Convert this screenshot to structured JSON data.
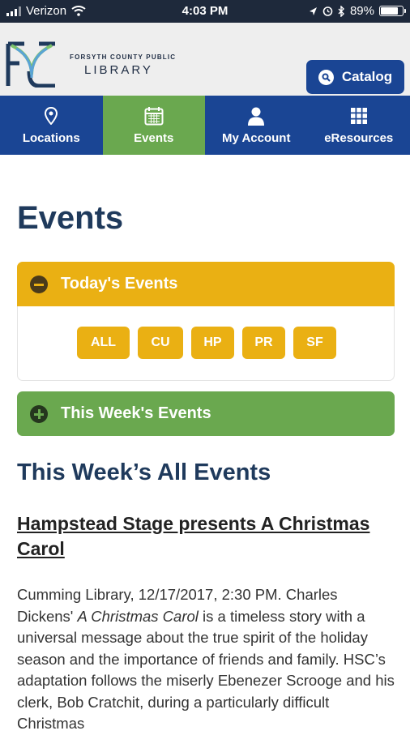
{
  "status_bar": {
    "carrier": "Verizon",
    "time": "4:03 PM",
    "battery": "89%",
    "battery_level": 0.89
  },
  "header": {
    "logo_small": "FORSYTH COUNTY PUBLIC",
    "logo_big": "LIBRARY",
    "catalog_label": "Catalog"
  },
  "nav": {
    "items": [
      {
        "label": "Locations",
        "icon": "location-pin-icon"
      },
      {
        "label": "Events",
        "icon": "calendar-icon",
        "active": true
      },
      {
        "label": "My Account",
        "icon": "user-icon"
      },
      {
        "label": "eResources",
        "icon": "grid-icon"
      }
    ]
  },
  "page": {
    "title": "Events",
    "today_events": "Today's Events",
    "filters": [
      "ALL",
      "CU",
      "HP",
      "PR",
      "SF"
    ],
    "week_events": "This Week's Events",
    "section_title": "This Week’s All Events",
    "event_title": "Hampstead Stage presents A Christmas Carol",
    "event_desc_1": "Cumming Library, 12/17/2017, 2:30 PM. Charles Dickens' ",
    "event_desc_italic": "A Christmas Carol",
    "event_desc_2": " is a timeless story with a universal message about the true spirit of the holiday season and the importance of friends and family. HSC’s adaptation follows the miserly Ebenezer Scrooge and his clerk, Bob Cratchit, during a particularly difficult Christmas"
  },
  "colors": {
    "nav_blue": "#1a4594",
    "events_green": "#6aa84f",
    "accent_gold": "#eab013",
    "title_navy": "#1f3a5c"
  }
}
